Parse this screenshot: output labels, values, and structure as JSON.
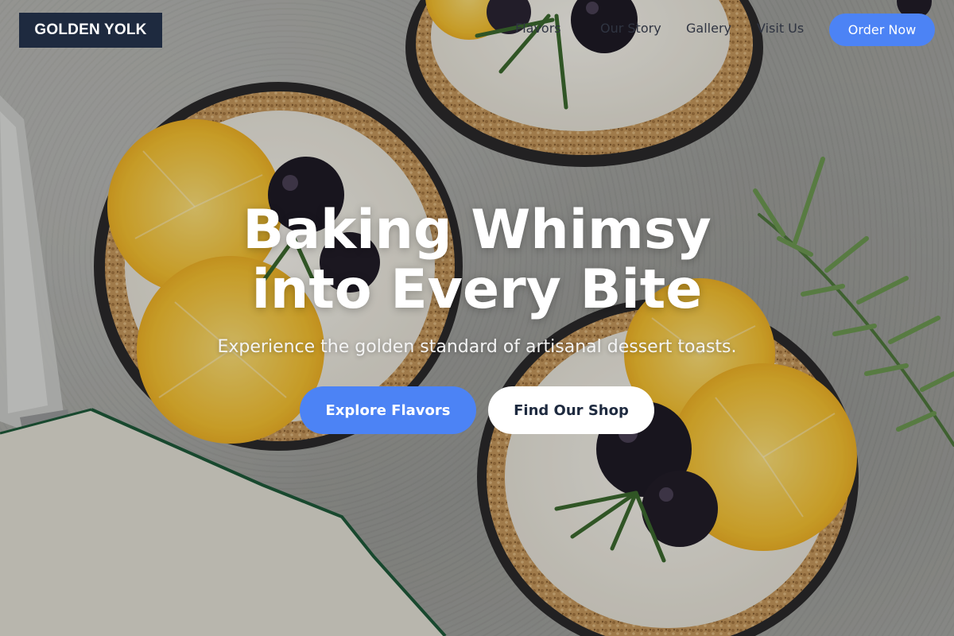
{
  "brand": {
    "logo_text": "GOLDEN YOLK"
  },
  "nav": {
    "links": [
      {
        "label": "Flavors"
      },
      {
        "label": "Our Story"
      },
      {
        "label": "Gallery"
      },
      {
        "label": "Visit Us"
      }
    ],
    "order_label": "Order Now"
  },
  "hero": {
    "headline_line1": "Baking Whimsy",
    "headline_line2": "into Every Bite",
    "subheadline": "Experience the golden standard of artisanal dessert toasts.",
    "primary_cta": "Explore Flavors",
    "secondary_cta": "Find Our Shop",
    "background_image": "dessert-tarts-photo"
  },
  "colors": {
    "accent": "#4c83f5",
    "logo_bg": "#1e2a3f",
    "nav_text": "#2f3441",
    "hero_text": "#ffffff"
  }
}
